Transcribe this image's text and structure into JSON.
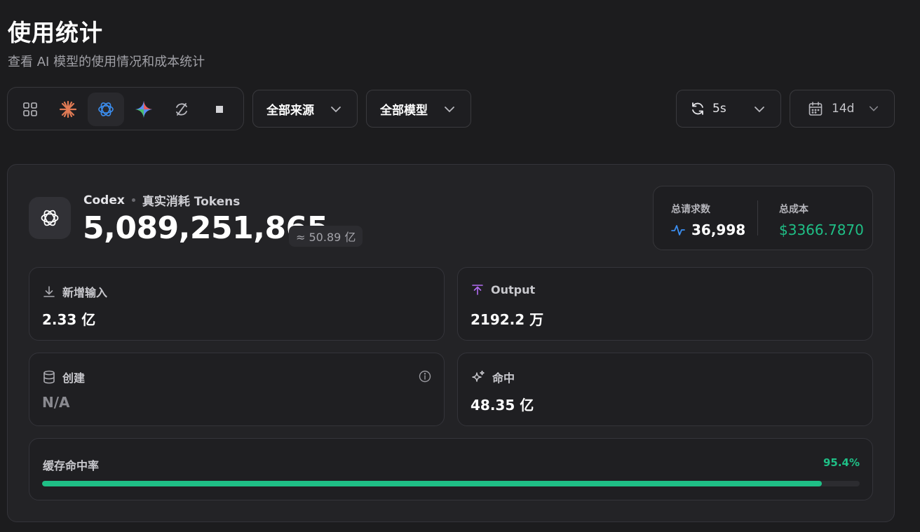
{
  "header": {
    "title": "使用统计",
    "subtitle": "查看 AI 模型的使用情况和成本统计"
  },
  "toolbar": {
    "providers": [
      {
        "icon": "grid-icon",
        "active": false
      },
      {
        "icon": "claude-icon",
        "active": false
      },
      {
        "icon": "openai-icon",
        "active": true
      },
      {
        "icon": "gemini-icon",
        "active": false
      },
      {
        "icon": "cycle-icon",
        "active": false
      },
      {
        "icon": "square-icon",
        "active": false
      }
    ],
    "source_filter": "全部来源",
    "model_filter": "全部模型",
    "refresh_interval": "5s",
    "date_range": "14d"
  },
  "overview": {
    "source": "Codex",
    "metric": "真实消耗 Tokens",
    "total_tokens": "5,089,251,865",
    "approx": "≈ 50.89 亿",
    "total_requests_label": "总请求数",
    "total_requests": "36,998",
    "total_cost_label": "总成本",
    "total_cost": "$3366.7870"
  },
  "stats": {
    "input_label": "新增输入",
    "input_value": "2.33 亿",
    "output_label": "Output",
    "output_value": "2192.2 万",
    "create_label": "创建",
    "create_value": "N/A",
    "hit_label": "命中",
    "hit_value": "48.35 亿"
  },
  "cache": {
    "label": "缓存命中率",
    "rate_text": "95.4%",
    "rate": 0.954
  },
  "colors": {
    "accent_green": "#1fbf86",
    "accent_blue": "#3b8ef0",
    "accent_purple": "#b36bf2",
    "claude_orange": "#e07a54"
  }
}
